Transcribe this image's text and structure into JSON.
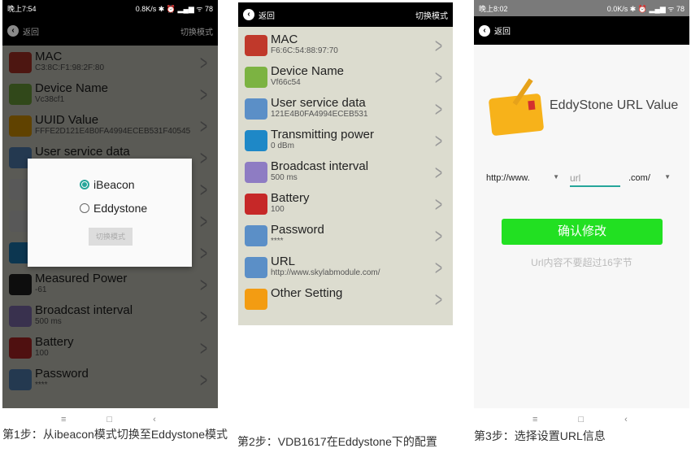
{
  "panel1": {
    "status_time": "晚上7:54",
    "status_right": "0.8K/s ✱ ⏰ ▂▄▆ ᯤ 78",
    "back": "返回",
    "switch": "切换模式",
    "items": [
      {
        "title": "MAC",
        "value": "C3:8C:F1:98:2F:80",
        "icon": "color-fan-icon",
        "color": "#c0392b"
      },
      {
        "title": "Device Name",
        "value": "Vc38cf1",
        "icon": "id-card-icon",
        "color": "#7cb342"
      },
      {
        "title": "UUID Value",
        "value": "FFFE2D121E4B0FA4994ECEB531F40545",
        "icon": "card-pen-icon",
        "color": "#f0a500"
      },
      {
        "title": "User service data",
        "value": "",
        "icon": "lock-key-icon",
        "color": "#5b8fc7"
      },
      {
        "title": "",
        "value": "",
        "icon": "password-pen-icon",
        "color": "#ddd"
      },
      {
        "title": "",
        "value": "",
        "icon": "password-pen-icon",
        "color": "#ddd"
      },
      {
        "title": "",
        "value": "",
        "icon": "beacon-pin-icon",
        "color": "#1e88c7"
      },
      {
        "title": "Measured Power",
        "value": "-61",
        "icon": "wifi-signal-icon",
        "color": "#222"
      },
      {
        "title": "Broadcast interval",
        "value": "500 ms",
        "icon": "arrows-icon",
        "color": "#8e7cc3"
      },
      {
        "title": "Battery",
        "value": "100",
        "icon": "battery-icon",
        "color": "#c62828"
      },
      {
        "title": "Password",
        "value": "****",
        "icon": "lock-key-icon",
        "color": "#5b8fc7"
      }
    ],
    "dialog": {
      "options": [
        {
          "label": "iBeacon",
          "selected": true
        },
        {
          "label": "Eddystone",
          "selected": false
        }
      ],
      "button": "切换模式"
    },
    "caption": "第1步：从ibeacon模式切换至Eddystone模式"
  },
  "panel2": {
    "back": "返回",
    "switch": "切换模式",
    "items": [
      {
        "title": "MAC",
        "value": "F6:6C:54:88:97:70",
        "icon": "color-fan-icon",
        "color": "#c0392b"
      },
      {
        "title": "Device Name",
        "value": "Vf66c54",
        "icon": "id-card-icon",
        "color": "#7cb342"
      },
      {
        "title": "User service data",
        "value": "121E4B0FA4994ECEB531",
        "icon": "lock-key-icon",
        "color": "#5b8fc7"
      },
      {
        "title": "Transmitting power",
        "value": "0 dBm",
        "icon": "beacon-pin-icon",
        "color": "#1e88c7"
      },
      {
        "title": "Broadcast interval",
        "value": "500 ms",
        "icon": "arrows-icon",
        "color": "#8e7cc3"
      },
      {
        "title": "Battery",
        "value": "100",
        "icon": "battery-icon",
        "color": "#c62828"
      },
      {
        "title": "Password",
        "value": "****",
        "icon": "lock-key-icon",
        "color": "#5b8fc7"
      },
      {
        "title": "URL",
        "value": "http://www.skylabmodule.com/",
        "icon": "lock-key-icon",
        "color": "#5b8fc7"
      },
      {
        "title": "Other Setting",
        "value": "",
        "icon": "gears-icon",
        "color": "#f39c12"
      }
    ],
    "caption": "第2步：VDB1617在Eddystone下的配置"
  },
  "panel3": {
    "status_time": "晚上8:02",
    "status_right": "0.0K/s ✱ ⏰ ▂▄▆ ᯤ 78",
    "back": "返回",
    "heading": "EddyStone URL Value",
    "prefix": "http://www.",
    "url_placeholder": "url",
    "suffix": ".com/",
    "confirm": "确认修改",
    "confirm_color": "#22e022",
    "hint": "Url内容不要超过16字节",
    "caption": "第3步：选择设置URL信息"
  },
  "nav": {
    "menu": "≡",
    "home": "□",
    "back": "‹"
  }
}
